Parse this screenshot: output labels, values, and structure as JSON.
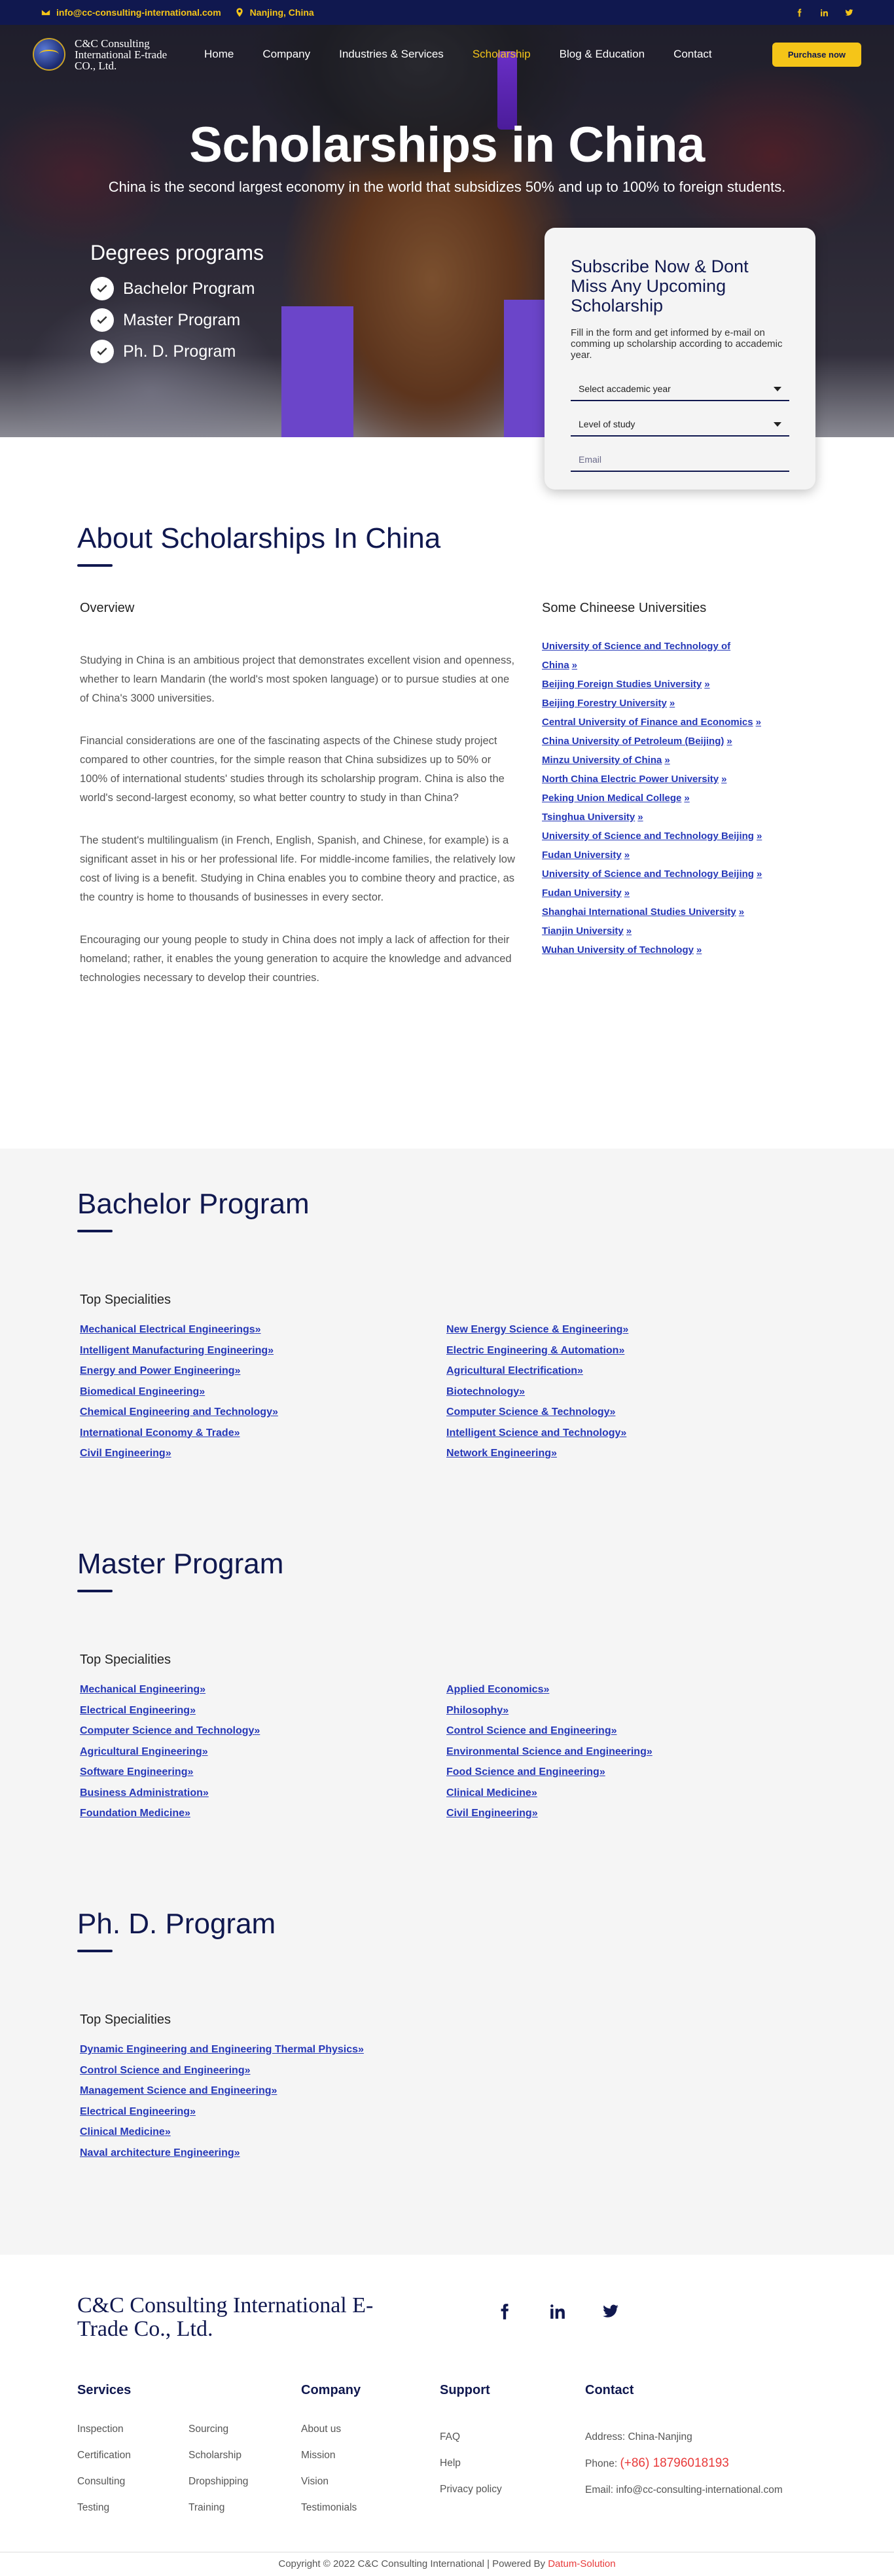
{
  "topbar": {
    "email": "info@cc-consulting-international.com",
    "location": "Nanjing, China",
    "social": [
      "facebook-icon",
      "linkedin-icon",
      "twitter-icon"
    ]
  },
  "nav": {
    "logo_text": "C&C Consulting International E-trade CO., Ltd.",
    "items": [
      {
        "label": "Home"
      },
      {
        "label": "Company"
      },
      {
        "label": "Industries & Services"
      },
      {
        "label": "Scholarship"
      },
      {
        "label": "Blog & Education"
      },
      {
        "label": "Contact"
      }
    ],
    "active_index": 3,
    "purchase_label": "Purchase now"
  },
  "hero": {
    "title": "Scholarships in China",
    "subtitle": "China is the second largest economy in the world that subsidizes 50% and up to 100% to foreign students.",
    "degrees_heading": "Degrees programs",
    "degrees": [
      "Bachelor Program",
      "Master Program",
      "Ph. D. Program"
    ]
  },
  "subscribe": {
    "title": "Subscribe Now & Dont Miss Any Upcoming Scholarship",
    "text": "Fill in the form and get informed  by e-mail on comming up scholarship according to accademic year.",
    "year_select": "Select accademic year",
    "level_select": "Level of study",
    "email_placeholder": "Email"
  },
  "about": {
    "title": "About Scholarships In China",
    "overview_heading": "Overview",
    "paragraphs": [
      "Studying in China is an ambitious project that demonstrates excellent vision and openness, whether to learn Mandarin (the world's most spoken language) or to pursue studies at one of China's 3000 universities.",
      "Financial considerations are one of the fascinating aspects of the Chinese study project compared to other countries, for the simple reason that China subsidizes up to 50% or 100% of international students' studies through its scholarship program. China is also the world's second-largest economy, so what better country to study in than China?",
      "The student's multilingualism (in French, English, Spanish, and Chinese, for example) is a significant asset in his or her professional life. For middle-income families, the relatively low cost of living is a benefit. Studying in China enables you to combine theory and practice, as the country is home to thousands of businesses in every sector.",
      "Encouraging our young people to study in China does not imply a lack of affection for their homeland; rather, it enables the young generation to acquire the knowledge and advanced technologies necessary to develop their countries."
    ],
    "universities_heading": "Some Chineese Universities",
    "universities": [
      "University of Science and Technology of China",
      "Beijing Foreign Studies University",
      "Beijing Forestry University",
      "Central University of Finance and Economics",
      "China University of Petroleum (Beijing)",
      "Minzu University of China",
      "North China Electric Power University",
      "Peking Union Medical College",
      "Tsinghua University",
      "University of Science and Technology Beijing",
      "Fudan University",
      "University of Science and Technology Beijing",
      "Fudan University",
      "Shanghai International Studies University",
      "Tianjin University",
      "Wuhan University of Technology"
    ]
  },
  "bachelor": {
    "title": "Bachelor Program",
    "spec_heading": "Top Specialities",
    "left": [
      "Mechanical Electrical Engineerings",
      "Intelligent Manufacturing Engineering",
      "Energy and Power Engineering",
      "Biomedical Engineering",
      "Chemical Engineering and Technology",
      "International Economy & Trade",
      "Civil Engineering"
    ],
    "right": [
      "New Energy Science & Engineering",
      "Electric Engineering & Automation",
      "Agricultural Electrification",
      "Biotechnology",
      "Computer Science & Technology",
      "Intelligent Science and Technology",
      "Network Engineering"
    ]
  },
  "master": {
    "title": "Master Program",
    "spec_heading": "Top Specialities",
    "left": [
      "Mechanical Engineering",
      "Electrical Engineering",
      "Computer Science and Technology",
      "Agricultural Engineering",
      "Software Engineering",
      "Business Administration",
      "Foundation Medicine"
    ],
    "right": [
      "Applied Economics",
      "Philosophy",
      "Control Science and Engineering",
      "Environmental Science and Engineering",
      "Food Science and Engineering",
      "Clinical Medicine",
      "Civil Engineering"
    ]
  },
  "phd": {
    "title": "Ph. D. Program",
    "spec_heading": "Top Specialities",
    "left": [
      "Dynamic Engineering and Engineering Thermal Physics",
      "Control Science and Engineering",
      "Management Science and Engineering",
      "Electrical Engineering",
      "Clinical Medicine",
      "Naval architecture Engineering"
    ]
  },
  "footer": {
    "logo_text": "C&C Consulting International E-Trade Co., Ltd.",
    "services_heading": "Services",
    "services_col1": [
      "Inspection",
      "Certification",
      "Consulting",
      "Testing"
    ],
    "services_col2": [
      "Sourcing",
      "Scholarship",
      "Dropshipping",
      "Training"
    ],
    "company_heading": "Company",
    "company": [
      "About us",
      "Mission",
      "Vision",
      "Testimonials"
    ],
    "support_heading": "Support",
    "support": [
      "FAQ",
      "Help",
      "Privacy policy"
    ],
    "contact_heading": "Contact",
    "address": "Address: China-Nanjing",
    "phone_label": "Phone: ",
    "phone": "(+86) 18796018193",
    "email": "Email: info@cc-consulting-international.com",
    "copyright": "Copyright © 2022 C&C Consulting International | Powered By ",
    "powered_by": "Datum-Solution"
  },
  "colors": {
    "navy": "#10184f",
    "accent_yellow": "#f5c518",
    "link_blue": "#2638b8",
    "brand_red": "#e83a3a"
  }
}
